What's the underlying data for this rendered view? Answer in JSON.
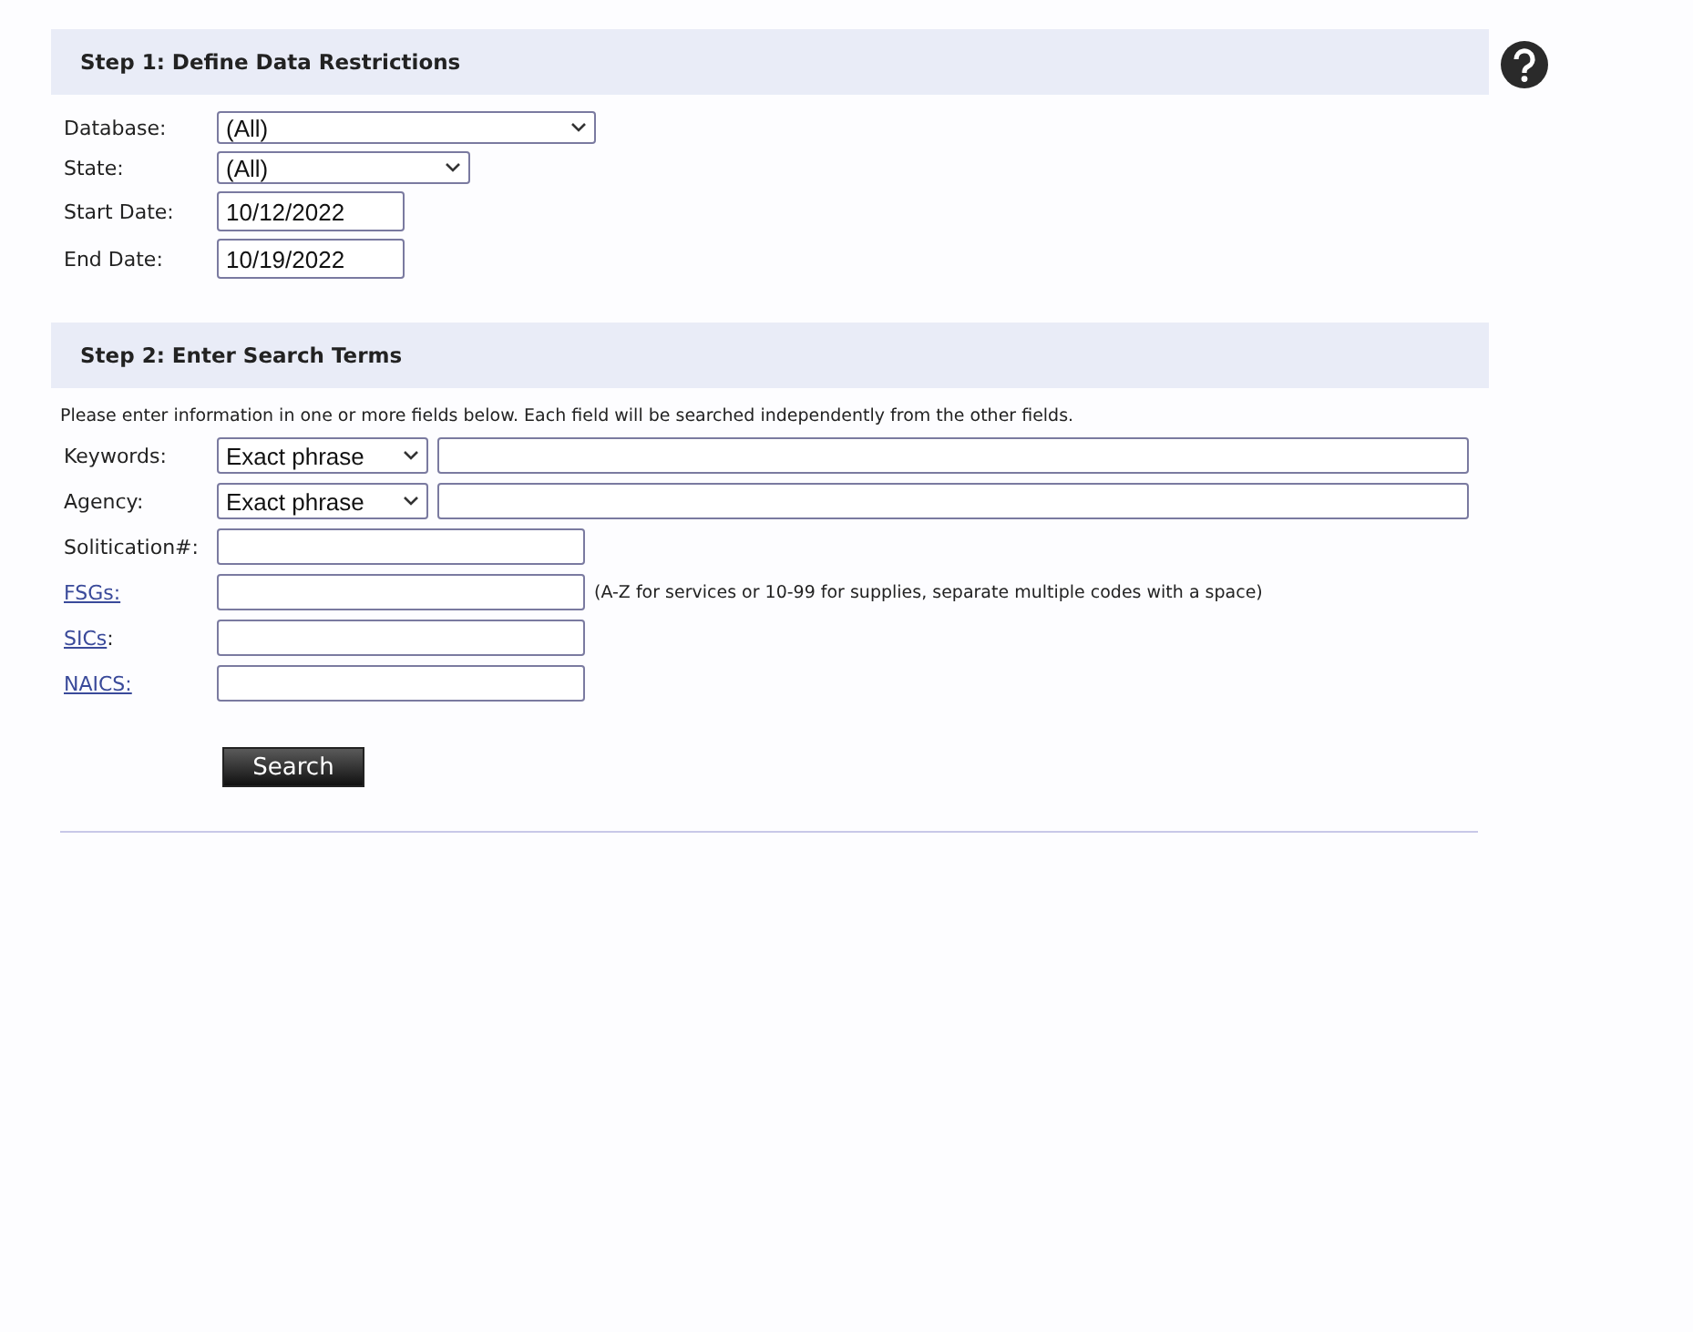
{
  "step1": {
    "title": "Step 1: Define Data Restrictions",
    "fields": [
      {
        "kind": "wideselect",
        "label": "Database:",
        "value": "(All)"
      },
      {
        "kind": "select",
        "label": "State:",
        "value": "(All)"
      },
      {
        "kind": "date",
        "label": "Start Date:",
        "value": "10/12/2022"
      },
      {
        "kind": "date",
        "label": "End Date:",
        "value": "10/19/2022"
      }
    ]
  },
  "step2": {
    "title": "Step 2: Enter Search Terms",
    "instructions": "Please enter information in one or more fields below. Each field will be searched independently from the other fields.",
    "fields": [
      {
        "kind": "match",
        "label": "Keywords:",
        "mode": "Exact phrase"
      },
      {
        "kind": "match",
        "label": "Agency:",
        "mode": "Exact phrase"
      },
      {
        "kind": "text",
        "label": "Solitication#:"
      },
      {
        "kind": "link",
        "label": "FSGs:",
        "hint": "(A-Z for services or 10-99 for supplies, separate multiple codes with a space)"
      },
      {
        "kind": "link",
        "label": "SICs",
        "suffix": ":"
      },
      {
        "kind": "link",
        "label": "NAICS:"
      }
    ]
  },
  "search_button": "Search"
}
